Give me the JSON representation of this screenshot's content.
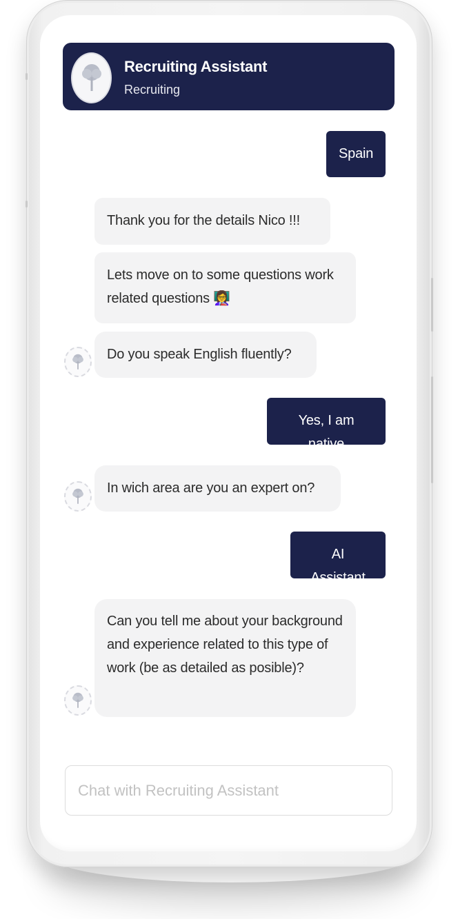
{
  "header": {
    "title": "Recruiting Assistant",
    "subtitle": "Recruiting",
    "avatar_icon": "tree-logo-icon"
  },
  "colors": {
    "header_bg": "#1c224b",
    "user_bubble_bg": "#1c224b",
    "bot_bubble_bg": "#f3f3f4",
    "text_dark": "#2b2b2b"
  },
  "messages": [
    {
      "sender": "user",
      "text": "Spain"
    },
    {
      "sender": "bot",
      "text": "Thank you for the details Nico !!!"
    },
    {
      "sender": "bot",
      "text": "Lets move on to some questions work related questions",
      "emoji": "👩‍🏫"
    },
    {
      "sender": "bot",
      "text": "Do you speak English fluently?"
    },
    {
      "sender": "user",
      "text": "Yes, I am native"
    },
    {
      "sender": "bot",
      "text": "In wich area are you an expert on?"
    },
    {
      "sender": "user",
      "text": "AI Assistant"
    },
    {
      "sender": "bot",
      "text": "Can you tell me about your background and experience related to this type of work (be as detailed as posible)?"
    }
  ],
  "input": {
    "placeholder": "Chat with Recruiting Assistant",
    "value": ""
  }
}
